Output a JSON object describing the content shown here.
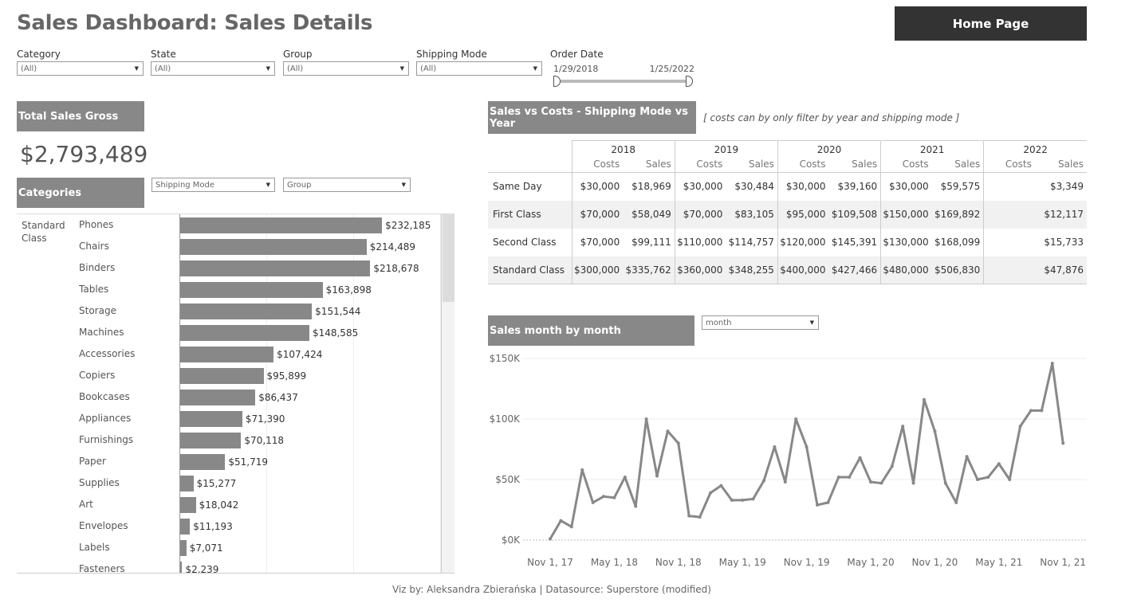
{
  "title": "Sales Dashboard: Sales Details",
  "home_button": "Home Page",
  "filters": {
    "category": {
      "label": "Category",
      "value": "(All)"
    },
    "state": {
      "label": "State",
      "value": "(All)"
    },
    "group": {
      "label": "Group",
      "value": "(All)"
    },
    "shipping_mode": {
      "label": "Shipping Mode",
      "value": "(All)"
    },
    "order_date": {
      "label": "Order Date",
      "start": "1/29/2018",
      "end": "1/25/2022"
    }
  },
  "total": {
    "header": "Total Sales Gross",
    "value": "$2,793,489"
  },
  "categories": {
    "header": "Categories",
    "dropdown_1": "Shipping Mode",
    "dropdown_2": "Group",
    "group_label": "Standard Class"
  },
  "table": {
    "header": "Sales vs Costs - Shipping Mode vs Year",
    "note": "[ costs can by only filter by year and shipping mode ]",
    "years": [
      "2018",
      "2019",
      "2020",
      "2021",
      "2022"
    ],
    "col_costs": "Costs",
    "col_sales": "Sales",
    "rows": [
      {
        "label": "Same Day",
        "c2018": "$30,000",
        "s2018": "$18,969",
        "c2019": "$30,000",
        "s2019": "$30,484",
        "c2020": "$30,000",
        "s2020": "$39,160",
        "c2021": "$30,000",
        "s2021": "$59,575",
        "c2022": "",
        "s2022": "$3,349"
      },
      {
        "label": "First Class",
        "c2018": "$70,000",
        "s2018": "$58,049",
        "c2019": "$70,000",
        "s2019": "$83,105",
        "c2020": "$95,000",
        "s2020": "$109,508",
        "c2021": "$150,000",
        "s2021": "$169,892",
        "c2022": "",
        "s2022": "$12,117"
      },
      {
        "label": "Second Class",
        "c2018": "$70,000",
        "s2018": "$99,111",
        "c2019": "$110,000",
        "s2019": "$114,757",
        "c2020": "$120,000",
        "s2020": "$145,391",
        "c2021": "$130,000",
        "s2021": "$168,099",
        "c2022": "",
        "s2022": "$15,733"
      },
      {
        "label": "Standard Class",
        "c2018": "$300,000",
        "s2018": "$335,762",
        "c2019": "$360,000",
        "s2019": "$348,255",
        "c2020": "$400,000",
        "s2020": "$427,466",
        "c2021": "$480,000",
        "s2021": "$506,830",
        "c2022": "",
        "s2022": "$47,876"
      }
    ]
  },
  "monthly": {
    "header": "Sales month by month",
    "dropdown": "month"
  },
  "footer": "Viz by: Aleksandra Zbierańska | Datasource: Superstore (modified)",
  "chart_data": [
    {
      "type": "bar",
      "orientation": "horizontal",
      "group": "Standard Class",
      "categories": [
        "Phones",
        "Chairs",
        "Binders",
        "Tables",
        "Storage",
        "Machines",
        "Accessories",
        "Copiers",
        "Bookcases",
        "Appliances",
        "Furnishings",
        "Paper",
        "Supplies",
        "Art",
        "Envelopes",
        "Labels",
        "Fasteners"
      ],
      "values": [
        232185,
        214489,
        218678,
        163898,
        151544,
        148585,
        107424,
        95899,
        86437,
        71390,
        70118,
        51719,
        15277,
        18042,
        11193,
        7071,
        2239
      ],
      "labels": [
        "$232,185",
        "$214,489",
        "$218,678",
        "$163,898",
        "$151,544",
        "$148,585",
        "$107,424",
        "$95,899",
        "$86,437",
        "$71,390",
        "$70,118",
        "$51,719",
        "$15,277",
        "$18,042",
        "$11,193",
        "$7,071",
        "$2,239"
      ],
      "xlim": [
        0,
        300000
      ],
      "grid": true
    },
    {
      "type": "line",
      "x": [
        "2017-11",
        "2017-12",
        "2018-01",
        "2018-02",
        "2018-03",
        "2018-04",
        "2018-05",
        "2018-06",
        "2018-07",
        "2018-08",
        "2018-09",
        "2018-10",
        "2018-11",
        "2018-12",
        "2019-01",
        "2019-02",
        "2019-03",
        "2019-04",
        "2019-05",
        "2019-06",
        "2019-07",
        "2019-08",
        "2019-09",
        "2019-10",
        "2019-11",
        "2019-12",
        "2020-01",
        "2020-02",
        "2020-03",
        "2020-04",
        "2020-05",
        "2020-06",
        "2020-07",
        "2020-08",
        "2020-09",
        "2020-10",
        "2020-11",
        "2020-12",
        "2021-01",
        "2021-02",
        "2021-03",
        "2021-04",
        "2021-05",
        "2021-06",
        "2021-07",
        "2021-08",
        "2021-09",
        "2021-10",
        "2021-11",
        "2021-12",
        "2022-01"
      ],
      "values": [
        1000,
        16000,
        11000,
        58000,
        31000,
        36000,
        35000,
        52000,
        28000,
        100000,
        53000,
        90000,
        80000,
        20000,
        19000,
        39000,
        45000,
        33000,
        33000,
        34000,
        49000,
        77000,
        48000,
        100000,
        77000,
        29000,
        31000,
        52000,
        52000,
        68000,
        48000,
        47000,
        61000,
        94000,
        47000,
        116000,
        90000,
        47000,
        31000,
        69000,
        50000,
        52000,
        63000,
        50000,
        94000,
        107000,
        107000,
        146000,
        80000
      ],
      "x_ticks": [
        "Nov 1, 17",
        "May 1, 18",
        "Nov 1, 18",
        "May 1, 19",
        "Nov 1, 19",
        "May 1, 20",
        "Nov 1, 20",
        "May 1, 21",
        "Nov 1, 21"
      ],
      "y_ticks": [
        "$0K",
        "$50K",
        "$100K",
        "$150K"
      ],
      "ylim": [
        0,
        150000
      ],
      "grid": true,
      "color": "#888888"
    }
  ]
}
